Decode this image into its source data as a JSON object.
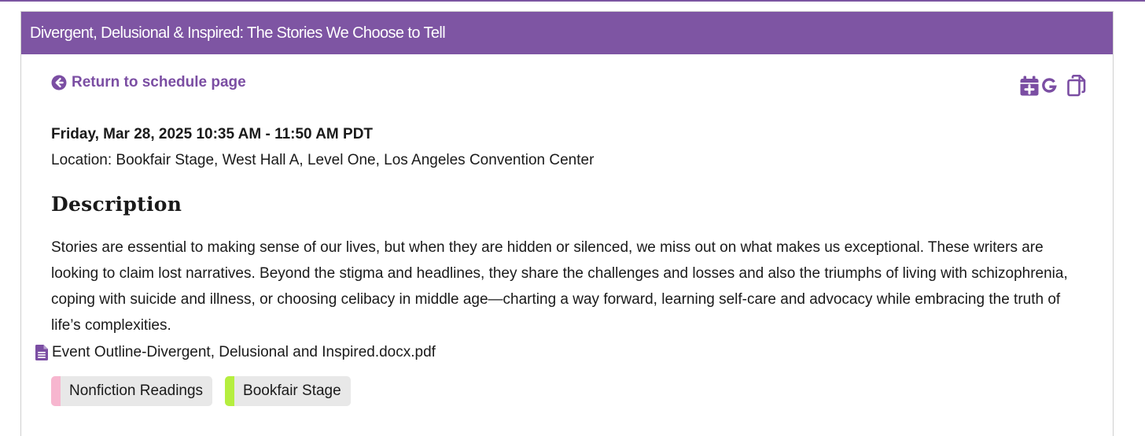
{
  "header": {
    "title": "Divergent, Delusional & Inspired: The Stories We Choose to Tell"
  },
  "nav": {
    "return_label": "Return to schedule page",
    "return_icon": "arrow-circle-left-icon"
  },
  "tools": {
    "items": [
      {
        "name": "add-to-calendar-icon"
      },
      {
        "name": "google-calendar-icon"
      },
      {
        "name": "copy-icon"
      }
    ]
  },
  "event": {
    "datetime": "Friday, Mar 28, 2025 10:35 AM - 11:50 AM PDT",
    "location": "Location: Bookfair Stage, West Hall A, Level One, Los Angeles Convention Center"
  },
  "description": {
    "heading": "Description",
    "text": "Stories are essential to making sense of our lives, but when they are hidden or silenced, we miss out on what makes us exceptional. These writers are looking to claim lost narratives. Beyond the stigma and headlines, they share the challenges and losses and also the triumphs of living with schizophrenia, coping with suicide and illness, or choosing celibacy in middle age—charting a way forward, learning self-care and advocacy while embracing the truth of life’s complexities."
  },
  "attachment": {
    "filename": "Event Outline-Divergent, Delusional and Inspired.docx.pdf",
    "icon": "document-icon"
  },
  "tags": [
    {
      "label": "Nonfiction Readings",
      "color": "#f7b6cf"
    },
    {
      "label": "Bookfair Stage",
      "color": "#b5ee3f"
    }
  ],
  "colors": {
    "accent": "#7e55a3",
    "link": "#7b4ea3"
  }
}
